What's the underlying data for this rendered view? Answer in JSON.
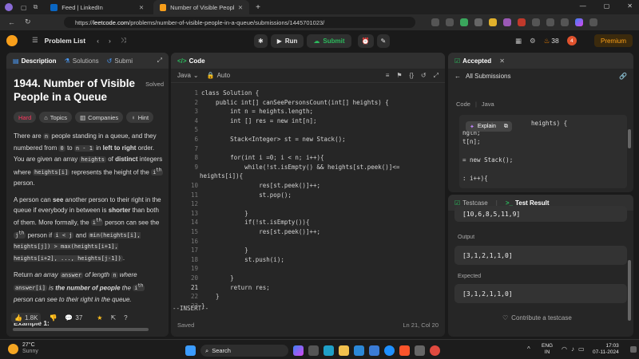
{
  "browser": {
    "tabs": [
      {
        "label": "Feed | LinkedIn",
        "color": "#0a66c2"
      },
      {
        "label": "Number of Visible People in a Qu",
        "color": "#f89f1b"
      }
    ],
    "url_prefix": "https://",
    "url_host": "leetcode.com",
    "url_path": "/problems/number-of-visible-people-in-a-queue/submissions/1445701023/"
  },
  "nav": {
    "problem_list": "Problem List",
    "run": "Run",
    "submit": "Submit",
    "streak": "38",
    "notif_count": "4",
    "premium": "Premium"
  },
  "left": {
    "tabs": [
      "Description",
      "Solutions",
      "Submi"
    ],
    "title": "1944. Number of Visible People in a Queue",
    "status": "Solved",
    "difficulty": "Hard",
    "tag_buttons": [
      "Topics",
      "Companies",
      "Hint"
    ],
    "para1_a": "There are",
    "para1_n": "n",
    "para1_b": "people standing in a queue, and they numbered from",
    "para1_zero": "0",
    "para1_to": "to",
    "para1_nm1": "n - 1",
    "para1_in": "in",
    "para1_ltr": "left to right",
    "para1_c": "order. You are given an array",
    "para1_heights": "heights",
    "para1_of": "of",
    "para1_distinct": "distinct",
    "para1_d": "integers where",
    "para1_heightsi": "heights[i]",
    "para1_e": "represents the height of the",
    "para1_ith": "i",
    "para1_th": "th",
    "para1_person": "person.",
    "para2_a": "A person can",
    "para2_see": "see",
    "para2_b": "another person to their right in the queue if everybody in between is",
    "para2_shorter": "shorter",
    "para2_c": "than both of them. More formally, the",
    "para2_d": "person can see the",
    "para2_j": "j",
    "para2_e": "person if",
    "para2_cond1": "i < j",
    "para2_and": "and",
    "para2_cond2": "min(heights[i], heights[j]) > max(heights[i+1], heights[i+2], ..., heights[j-1])",
    "para3_a": "Return",
    "para3_array": "an array",
    "para3_answer": "answer",
    "para3_len": "of length",
    "para3_where": "where",
    "para3_answeri": "answer[i]",
    "para3_is": "is",
    "para3_number": "the number of people",
    "para3_the": "the",
    "para3_cansee": "person can see to their right in the queue.",
    "example": "Example 1:",
    "likes": "1.8K",
    "comments": "37"
  },
  "editor": {
    "header": "Code",
    "language": "Java",
    "auto": "Auto",
    "lines": [
      {
        "n": "1",
        "t": "class Solution {"
      },
      {
        "n": "2",
        "t": "    public int[] canSeePersonsCount(int[] heights) {"
      },
      {
        "n": "3",
        "t": "        int n = heights.length;"
      },
      {
        "n": "4",
        "t": "        int [] res = new int[n];"
      },
      {
        "n": "5",
        "t": ""
      },
      {
        "n": "6",
        "t": "        Stack<Integer> st = new Stack();"
      },
      {
        "n": "7",
        "t": ""
      },
      {
        "n": "8",
        "t": "        for(int i =0; i < n; i++){"
      },
      {
        "n": "9",
        "t": "            while(!st.isEmpty() && heights[st.peek()]<="
      },
      {
        "n": "",
        "t": "heights[i]){"
      },
      {
        "n": "10",
        "t": "                res[st.peek()]++;"
      },
      {
        "n": "11",
        "t": "                st.pop();"
      },
      {
        "n": "12",
        "t": ""
      },
      {
        "n": "13",
        "t": "            }"
      },
      {
        "n": "14",
        "t": "            if(!st.isEmpty()){"
      },
      {
        "n": "15",
        "t": "                res[st.peek()]++;"
      },
      {
        "n": "16",
        "t": ""
      },
      {
        "n": "17",
        "t": "            }"
      },
      {
        "n": "18",
        "t": "            st.push(i);"
      },
      {
        "n": "19",
        "t": ""
      },
      {
        "n": "20",
        "t": "        }"
      },
      {
        "n": "21",
        "t": "        return res;"
      },
      {
        "n": "22",
        "t": "    }"
      },
      {
        "n": "23",
        "t": "}"
      }
    ],
    "mode": "--INSERT--",
    "saved": "Saved",
    "cursor": "Ln 21, Col 20"
  },
  "right": {
    "accepted": "Accepted",
    "all_submissions": "All Submissions",
    "code_label": "Code",
    "lang": "Java",
    "snippet": [
      "heights) {",
      "ngth;",
      "t[n];",
      "",
      "= new Stack();",
      "",
      ": i++){"
    ],
    "explain": "Explain",
    "testcase_tab": "Testcase",
    "result_tab": "Test Result",
    "input_value": "[10,6,8,5,11,9]",
    "output_label": "Output",
    "output_value": "[3,1,2,1,1,0]",
    "expected_label": "Expected",
    "expected_value": "[3,1,2,1,1,0]",
    "contribute": "Contribute a testcase"
  },
  "taskbar": {
    "temp": "27°C",
    "weather": "Sunny",
    "search": "Search",
    "lang1": "ENG",
    "lang2": "IN",
    "time": "17:03",
    "date": "07-11-2024"
  }
}
